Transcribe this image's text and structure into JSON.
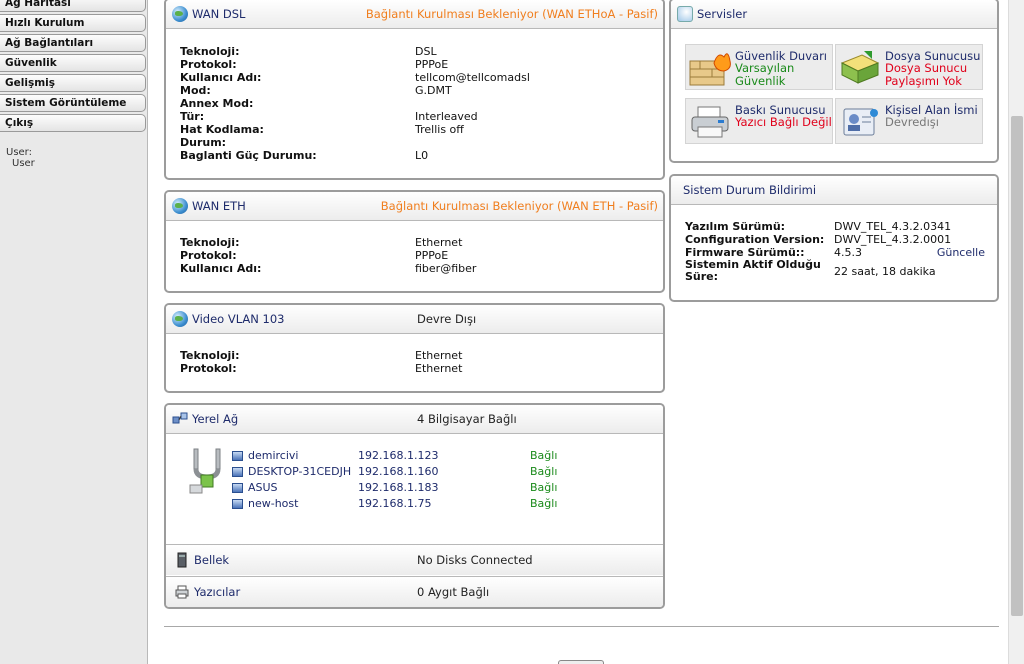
{
  "sidebar": {
    "items": [
      {
        "label": "Ağ Haritası"
      },
      {
        "label": "Hızlı Kurulum"
      },
      {
        "label": "Ağ Bağlantıları"
      },
      {
        "label": "Güvenlik"
      },
      {
        "label": "Gelişmiş"
      },
      {
        "label": "Sistem Görüntüleme"
      },
      {
        "label": "Çıkış"
      }
    ],
    "user_label": "User:",
    "user_value": "User"
  },
  "wan_dsl": {
    "title": "WAN DSL",
    "status": "Bağlantı Kurulması Bekleniyor (WAN ETHoA - Pasif)",
    "rows": [
      {
        "key": "Teknoloji:",
        "value": "DSL"
      },
      {
        "key": "Protokol:",
        "value": "PPPoE"
      },
      {
        "key": "Kullanıcı Adı:",
        "value": "tellcom@tellcomadsl"
      },
      {
        "key": "Mod:",
        "value": "G.DMT"
      },
      {
        "key": "Annex Mod:",
        "value": ""
      },
      {
        "key": "Tür:",
        "value": "Interleaved"
      },
      {
        "key": "Hat Kodlama:",
        "value": "Trellis off"
      },
      {
        "key": "Durum:",
        "value": ""
      },
      {
        "key": "Baglanti Güç Durumu:",
        "value": "L0"
      }
    ]
  },
  "wan_eth": {
    "title": "WAN ETH",
    "status": "Bağlantı Kurulması Bekleniyor (WAN ETH - Pasif)",
    "rows": [
      {
        "key": "Teknoloji:",
        "value": "Ethernet"
      },
      {
        "key": "Protokol:",
        "value": "PPPoE"
      },
      {
        "key": "Kullanıcı Adı:",
        "value": "fiber@fiber"
      }
    ]
  },
  "video_vlan": {
    "title": "Video VLAN 103",
    "status": "Devre Dışı",
    "rows": [
      {
        "key": "Teknoloji:",
        "value": "Ethernet"
      },
      {
        "key": "Protokol:",
        "value": "Ethernet"
      }
    ]
  },
  "lan": {
    "title": "Yerel Ağ",
    "status": "4 Bilgisayar Bağlı",
    "hosts": [
      {
        "name": "demircivi",
        "ip": "192.168.1.123",
        "status": "Bağlı"
      },
      {
        "name": "DESKTOP-31CEDJH",
        "ip": "192.168.1.160",
        "status": "Bağlı"
      },
      {
        "name": "ASUS",
        "ip": "192.168.1.183",
        "status": "Bağlı"
      },
      {
        "name": "new-host",
        "ip": "192.168.1.75",
        "status": "Bağlı"
      }
    ],
    "storage_title": "Bellek",
    "storage_status": "No Disks Connected",
    "printers_title": "Yazıcılar",
    "printers_status": "0 Aygıt Bağlı"
  },
  "services": {
    "title": "Servisler",
    "items": [
      {
        "title": "Güvenlik Duvarı",
        "line1": "Varsayılan",
        "line2": "Güvenlik"
      },
      {
        "title": "Dosya Sunucusu",
        "line1": "Dosya Sunucu",
        "line2": "Paylaşımı Yok"
      },
      {
        "title": "Baskı Sunucusu",
        "line1": "Yazıcı Bağlı Değil",
        "line2": ""
      },
      {
        "title": "Kişisel Alan İsmi",
        "line1": "Devredışı",
        "line2": ""
      }
    ]
  },
  "system_status": {
    "title": "Sistem Durum Bildirimi",
    "software_label": "Yazılım Sürümü:",
    "software_value": "DWV_TEL_4.3.2.0341",
    "config_label": "Configuration Version:",
    "config_value": "DWV_TEL_4.3.2.0001",
    "firmware_label": "Firmware Sürümü::",
    "firmware_value": "4.5.3",
    "update_link": "Güncelle",
    "uptime_label": "Sistemin Aktif Olduğu Süre:",
    "uptime_value": "22 saat, 18 dakika"
  }
}
